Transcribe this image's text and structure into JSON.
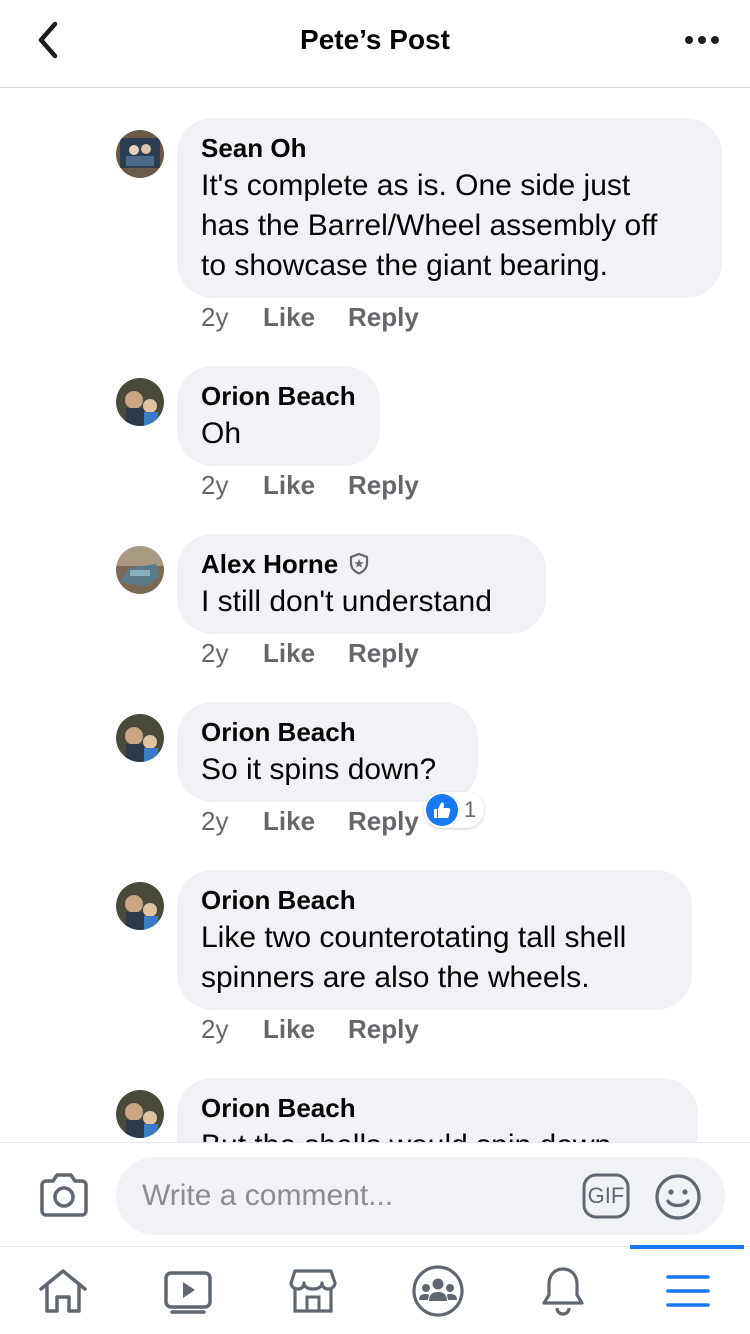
{
  "header": {
    "title": "Pete’s Post",
    "back_icon": "chevron-left-icon",
    "more_icon": "more-horizontal-icon"
  },
  "comments": [
    {
      "author": "Sean Oh",
      "text": "It's complete as is. One side just\nhas the Barrel/Wheel assembly off\nto showcase the giant bearing.",
      "time": "2y",
      "like_label": "Like",
      "reply_label": "Reply"
    },
    {
      "author": "Orion Beach",
      "text": "Oh",
      "time": "2y",
      "like_label": "Like",
      "reply_label": "Reply"
    },
    {
      "author": "Alex Horne",
      "badge_icon": "shield-badge-icon",
      "text": "I still don't understand",
      "time": "2y",
      "like_label": "Like",
      "reply_label": "Reply"
    },
    {
      "author": "Orion Beach",
      "text": "So it spins down?",
      "time": "2y",
      "like_label": "Like",
      "reply_label": "Reply",
      "reaction_count": "1",
      "reaction_icon": "thumbs-up-icon"
    },
    {
      "author": "Orion Beach",
      "text": "Like two counterotating tall shell\nspinners are also the wheels.",
      "time": "2y",
      "like_label": "Like",
      "reply_label": "Reply"
    },
    {
      "author": "Orion Beach",
      "text": "But the shells would spin down",
      "time": "",
      "like_label": "",
      "reply_label": ""
    }
  ],
  "composer": {
    "placeholder": "Write a comment...",
    "camera_icon": "camera-icon",
    "gif_label": "GIF",
    "emoji_icon": "smiley-icon"
  },
  "bottom_nav": {
    "items": [
      "home-icon",
      "video-icon",
      "marketplace-icon",
      "groups-icon",
      "bell-icon",
      "menu-icon"
    ],
    "active": "menu-icon",
    "accent": "#1877f2"
  },
  "colors": {
    "bubble": "#f0f2f5",
    "secondary_text": "#65676b",
    "icon": "#606770"
  }
}
